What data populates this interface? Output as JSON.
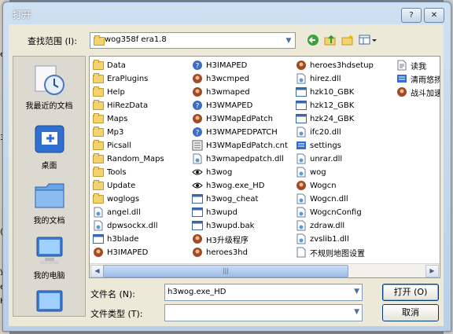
{
  "background": {
    "left_frags": [
      "ero",
      "3",
      "(",
      "y",
      "ei",
      "M",
      "H"
    ],
    "right_frags": [
      "F",
      "M",
      "Y"
    ]
  },
  "window": {
    "title": "打开",
    "help_label": "?",
    "close_label": "✕"
  },
  "lookin": {
    "label": "查找范围 (I):",
    "value": "wog358f era1.8"
  },
  "places": [
    {
      "label": "我最近的文档",
      "icon": "recent-documents-icon"
    },
    {
      "label": "桌面",
      "icon": "desktop-icon"
    },
    {
      "label": "我的文档",
      "icon": "my-documents-icon"
    },
    {
      "label": "我的电脑",
      "icon": "my-computer-icon"
    },
    {
      "label": "",
      "icon": "network-icon"
    }
  ],
  "files": [
    {
      "name": "Data",
      "type": "folder"
    },
    {
      "name": "EraPlugins",
      "type": "folder"
    },
    {
      "name": "Help",
      "type": "folder"
    },
    {
      "name": "HiRezData",
      "type": "folder"
    },
    {
      "name": "Maps",
      "type": "folder"
    },
    {
      "name": "Mp3",
      "type": "folder"
    },
    {
      "name": "Picsall",
      "type": "folder"
    },
    {
      "name": "Random_Maps",
      "type": "folder"
    },
    {
      "name": "Tools",
      "type": "folder"
    },
    {
      "name": "Update",
      "type": "folder"
    },
    {
      "name": "woglogs",
      "type": "folder"
    },
    {
      "name": "angel.dll",
      "type": "dll"
    },
    {
      "name": "dpwsockx.dll",
      "type": "dll"
    },
    {
      "name": "h3blade",
      "type": "exe"
    },
    {
      "name": "H3IMAPED",
      "type": "app"
    },
    {
      "name": "H3IMAPED",
      "type": "help"
    },
    {
      "name": "h3wcmped",
      "type": "app"
    },
    {
      "name": "h3wmaped",
      "type": "app"
    },
    {
      "name": "H3WMAPED",
      "type": "help"
    },
    {
      "name": "H3WMapEdPatch",
      "type": "app"
    },
    {
      "name": "H3WMAPEDPATCH",
      "type": "help"
    },
    {
      "name": "H3WMapEdPatch.cnt",
      "type": "cnt"
    },
    {
      "name": "h3wmapedpatch.dll",
      "type": "dll"
    },
    {
      "name": "h3wog",
      "type": "eye"
    },
    {
      "name": "h3wog.exe_HD",
      "type": "eye"
    },
    {
      "name": "h3wog_cheat",
      "type": "exe"
    },
    {
      "name": "h3wupd",
      "type": "exe"
    },
    {
      "name": "h3wupd.bak",
      "type": "exe"
    },
    {
      "name": "H3升级程序",
      "type": "app"
    },
    {
      "name": "heroes3hd",
      "type": "app"
    },
    {
      "name": "heroes3hdsetup",
      "type": "app"
    },
    {
      "name": "hirez.dll",
      "type": "dll"
    },
    {
      "name": "hzk10_GBK",
      "type": "exe"
    },
    {
      "name": "hzk12_GBK",
      "type": "exe"
    },
    {
      "name": "hzk24_GBK",
      "type": "exe"
    },
    {
      "name": "ifc20.dll",
      "type": "dll"
    },
    {
      "name": "settings",
      "type": "settings"
    },
    {
      "name": "unrar.dll",
      "type": "dll"
    },
    {
      "name": "wog",
      "type": "dll"
    },
    {
      "name": "Wogcn",
      "type": "app"
    },
    {
      "name": "Wogcn.dll",
      "type": "dll"
    },
    {
      "name": "WogcnConfig",
      "type": "dll"
    },
    {
      "name": "zdraw.dll",
      "type": "dll"
    },
    {
      "name": "zvslib1.dll",
      "type": "dll"
    },
    {
      "name": "不规则地图设置",
      "type": "shortcut"
    },
    {
      "name": "读我",
      "type": "txt"
    },
    {
      "name": "清雨悠扬",
      "type": "settings"
    },
    {
      "name": "战斗加速",
      "type": "app"
    }
  ],
  "filename": {
    "label": "文件名 (N):",
    "value": "h3wog.exe_HD"
  },
  "filetype": {
    "label": "文件类型 (T):",
    "value": ""
  },
  "buttons": {
    "open": "打开 (O)",
    "cancel": "取消"
  },
  "scroll": {
    "left": "◀",
    "right": "▶",
    "grip": "|||"
  },
  "colors": {
    "title_bar": "#b9cfe7",
    "client": "#ece9d8",
    "accent": "#316ac5"
  }
}
